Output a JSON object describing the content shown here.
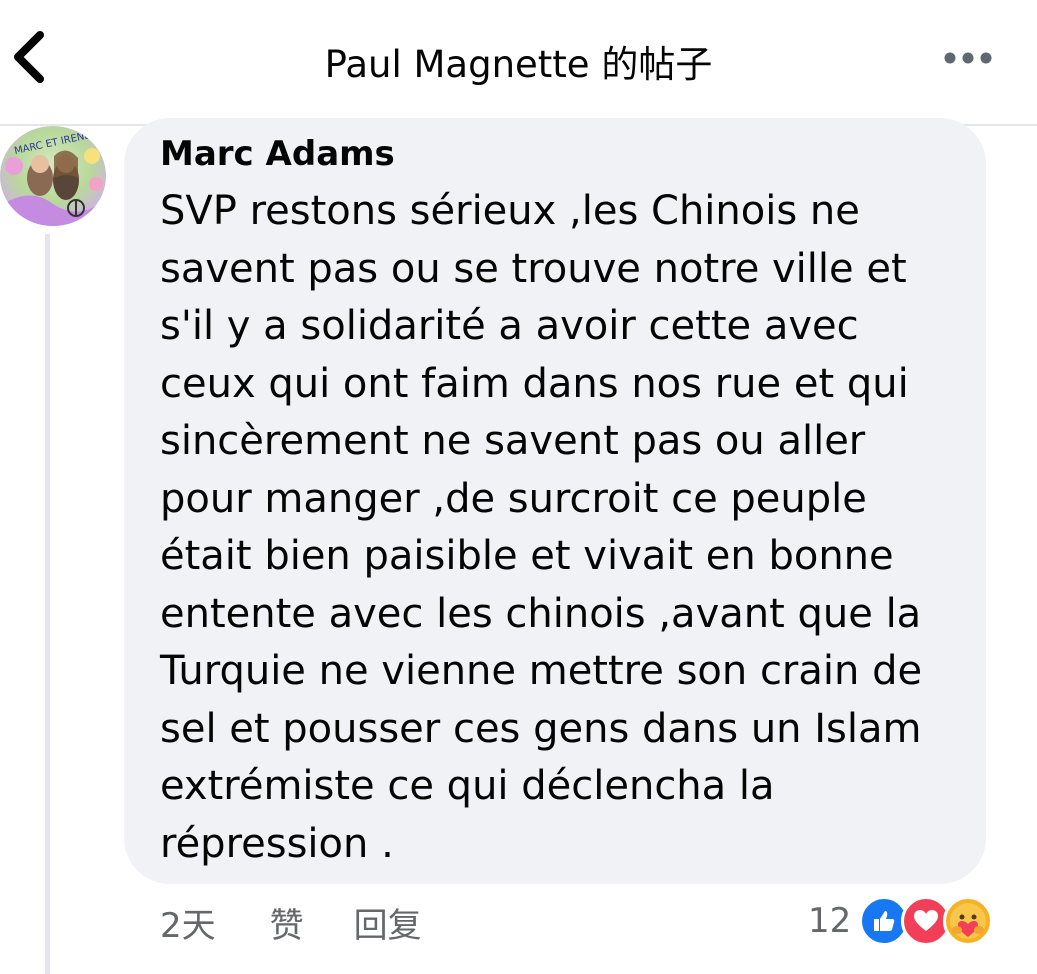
{
  "header": {
    "title": "Paul Magnette 的帖子",
    "back_icon": "chevron-left-icon",
    "more_icon": "more-dots-icon"
  },
  "comment": {
    "avatar_text": "MARC ET IRENE",
    "author": "Marc Adams",
    "text": "SVP restons sérieux ,les Chinois ne\nsavent pas ou se trouve notre ville et\ns'il y a solidarité a avoir cette avec\nceux qui ont faim dans nos rue et qui\nsincèrement ne savent pas ou aller\npour manger ,de surcroit ce peuple\nétait bien paisible et vivait en bonne\nentente avec les chinois ,avant que la\nTurquie ne vienne mettre son crain de\nsel et pousser ces gens dans un Islam\nextrémiste ce qui déclencha la\nrépression .",
    "time": "2天",
    "like_label": "赞",
    "reply_label": "回复",
    "reaction_count": "12",
    "reactions": [
      "like-reaction-icon",
      "love-reaction-icon",
      "care-reaction-icon"
    ]
  },
  "colors": {
    "bubble_bg": "#f0f2f5",
    "text": "#050505",
    "secondary_text": "#65676b",
    "like_blue": "#1877f2",
    "love_red": "#f33e58",
    "care_yellow": "#f7b125"
  }
}
